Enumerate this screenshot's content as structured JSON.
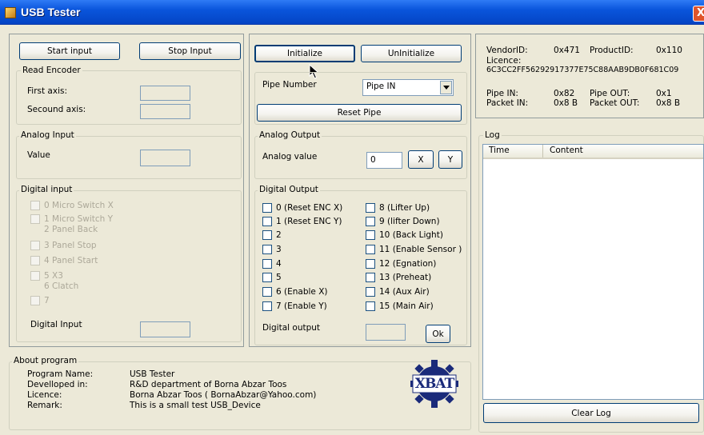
{
  "window": {
    "title": "USB Tester",
    "close_glyph": "X"
  },
  "input_buttons": {
    "start": "Start input",
    "stop": "Stop Input"
  },
  "read_encoder": {
    "legend": "Read Encoder",
    "first_axis": "First axis:",
    "second_axis": "Secound axis:"
  },
  "analog_input": {
    "legend": "Analog Input",
    "value_label": "Value"
  },
  "digital_input": {
    "legend": "Digital input",
    "items": [
      "0 Micro Switch X",
      "1 Micro Switch Y",
      "2 Panel Back",
      "3 Panel Stop",
      "4 Panel Start",
      "5 X3",
      "6 Clatch",
      "7"
    ],
    "value_label": "Digital Input"
  },
  "init_buttons": {
    "initialize": "Initialize",
    "uninitialize": "UnInitialize"
  },
  "pipe": {
    "label": "Pipe Number",
    "selected": "Pipe IN",
    "reset": "Reset Pipe"
  },
  "analog_output": {
    "legend": "Analog Output",
    "label": "Analog value",
    "value": "0",
    "x_button": "X",
    "y_button": "Y"
  },
  "digital_output": {
    "legend": "Digital Output",
    "left": [
      "0 (Reset ENC X)",
      "1 (Reset ENC Y)",
      "2",
      "3",
      "4",
      "5",
      "6 (Enable X)",
      "7 (Enable Y)"
    ],
    "right": [
      "8 (Lifter Up)",
      "9 (lifter Down)",
      "10 (Back Light)",
      "11 (Enable Sensor )",
      "12 (Egnation)",
      "13 (Preheat)",
      "14 (Aux Air)",
      "15 (Main Air)"
    ],
    "value_label": "Digital output",
    "ok_button": "Ok"
  },
  "device_info": {
    "vendor_label": "VendorID:",
    "vendor_value": "0x471",
    "product_label": "ProductID:",
    "product_value": "0x110",
    "licence_label": "Licence:",
    "licence_value": "6C3CC2FF56292917377E75C88AAB9DB0F681C09",
    "pipe_in_label": "Pipe IN:",
    "pipe_in_value": "0x82",
    "pipe_out_label": "Pipe OUT:",
    "pipe_out_value": "0x1",
    "packet_in_label": "Packet IN:",
    "packet_in_value": "0x8 B",
    "packet_out_label": "Packet OUT:",
    "packet_out_value": "0x8 B"
  },
  "log": {
    "legend": "Log",
    "columns": [
      "Time",
      "Content"
    ],
    "clear_button": "Clear Log"
  },
  "about": {
    "legend": "About program",
    "rows": [
      {
        "key": "Program Name:",
        "value": "USB Tester"
      },
      {
        "key": "Develloped in:",
        "value": "R&D department of Borna Abzar Toos"
      },
      {
        "key": "Licence:",
        "value": "Borna Abzar Toos ( BornaAbzar@Yahoo.com)"
      },
      {
        "key": "Remark:",
        "value": "This is a small test USB_Device"
      }
    ],
    "logo_text": "XBAT"
  }
}
